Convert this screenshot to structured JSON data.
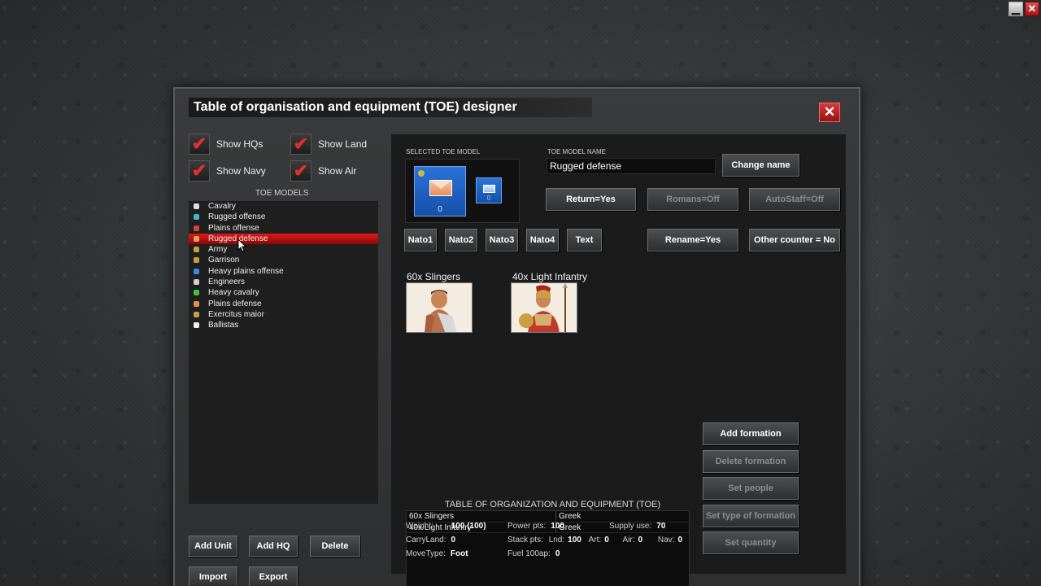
{
  "window_controls": {
    "minimize": "▁",
    "close": "✕"
  },
  "dialog": {
    "title": "Table of organisation and equipment (TOE) designer",
    "close": "✕"
  },
  "filters": [
    {
      "label": "Show HQs",
      "checked": true
    },
    {
      "label": "Show Land",
      "checked": true
    },
    {
      "label": "Show Navy",
      "checked": true
    },
    {
      "label": "Show Air",
      "checked": true
    }
  ],
  "check_glyph": "✔",
  "toe_models_label": "TOE MODELS",
  "toe_models": [
    {
      "label": "Cavalry",
      "icon_color": "#e0e0e0"
    },
    {
      "label": "Rugged offense",
      "icon_color": "#3fb6d6"
    },
    {
      "label": "Plains offense",
      "icon_color": "#d84040"
    },
    {
      "label": "Rugged defense",
      "icon_color": "#e0a060",
      "selected": true
    },
    {
      "label": "Army",
      "icon_color": "#c8a040"
    },
    {
      "label": "Garrison",
      "icon_color": "#c8a040"
    },
    {
      "label": "Heavy plains offense",
      "icon_color": "#3a8ae0"
    },
    {
      "label": "Engineers",
      "icon_color": "#d0d0d0"
    },
    {
      "label": "Heavy cavalry",
      "icon_color": "#40c040"
    },
    {
      "label": "Plains defense",
      "icon_color": "#e09050"
    },
    {
      "label": "Exercitus maior",
      "icon_color": "#c8a040"
    },
    {
      "label": "Ballistas",
      "icon_color": "#f0f0f0"
    }
  ],
  "left_buttons": {
    "add_unit": "Add Unit",
    "add_hq": "Add HQ",
    "delete": "Delete",
    "import": "Import",
    "export": "Export"
  },
  "selected_model": {
    "label": "SELECTED TOE MODEL",
    "counter_value": "0",
    "small_counter_value": "0"
  },
  "model_name": {
    "label": "TOE MODEL NAME",
    "value": "Rugged defense",
    "change_button": "Change name"
  },
  "toggles": {
    "return": "Return=Yes",
    "romans": "Romans=Off",
    "autostaff": "AutoStaff=Off",
    "rename": "Rename=Yes",
    "other_counter": "Other counter = No"
  },
  "nato_buttons": [
    "Nato1",
    "Nato2",
    "Nato3",
    "Nato4",
    "Text"
  ],
  "units": [
    {
      "label": "60x Slingers"
    },
    {
      "label": "40x Light Infantry"
    }
  ],
  "toe_table": {
    "title": "TABLE OF ORGANIZATION AND EQUIPMENT (TOE)",
    "rows": [
      {
        "name": "60x Slingers",
        "people": "Greek"
      },
      {
        "name": "40x Light Infantry",
        "people": "Greek"
      }
    ]
  },
  "formation_buttons": {
    "add": "Add formation",
    "delete": "Delete formation",
    "set_people": "Set people",
    "set_type": "Set type of formation",
    "set_quantity": "Set quantity"
  },
  "stats": {
    "weight_label": "Weight:",
    "weight": "100 (100)",
    "carryland_label": "CarryLand:",
    "carryland": "0",
    "movetype_label": "MoveType:",
    "movetype": "Foot",
    "power_label": "Power pts:",
    "power": "100",
    "stack_label": "Stack pts:",
    "lnd_label": "Lnd:",
    "lnd": "100",
    "art_label": "Art:",
    "art": "0",
    "air_label": "Air:",
    "air": "0",
    "nav_label": "Nav:",
    "nav": "0",
    "fuel_label": "Fuel 100ap:",
    "fuel": "0",
    "supply_label": "Supply use:",
    "supply": "70"
  }
}
